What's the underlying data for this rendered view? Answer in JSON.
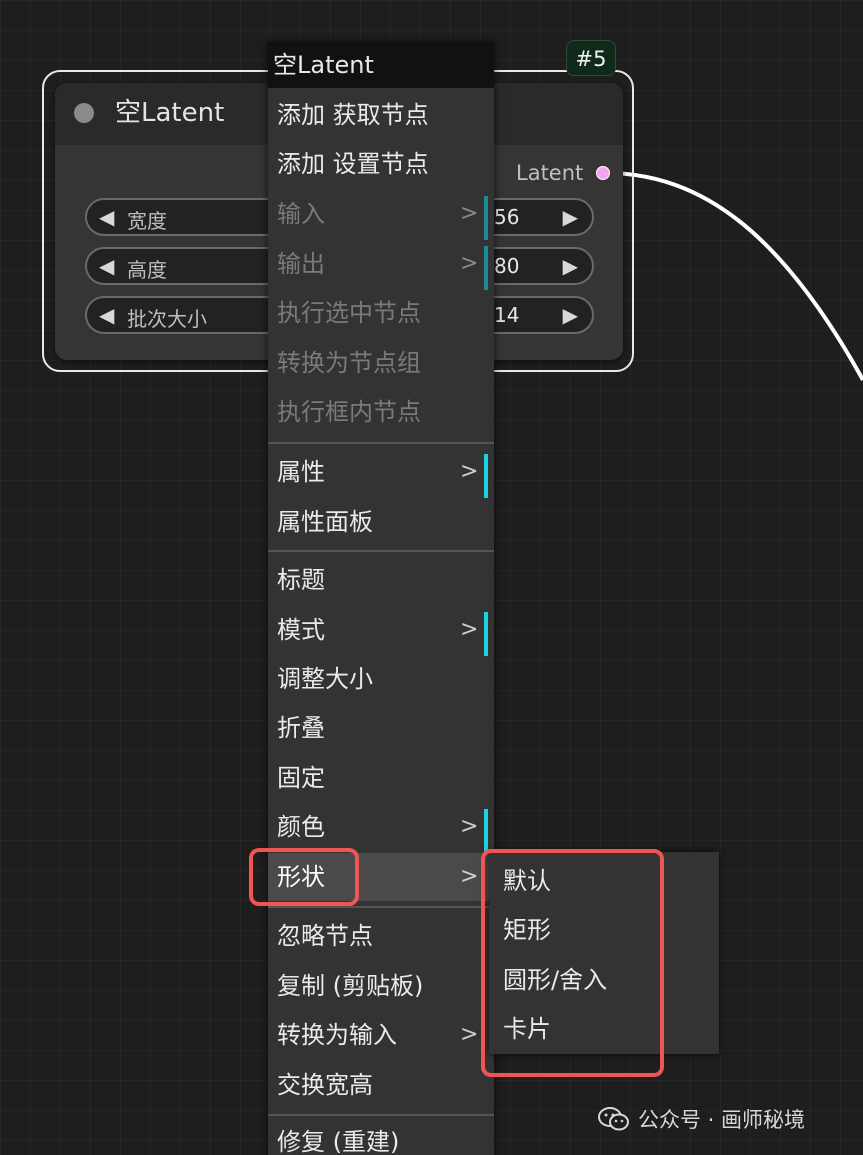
{
  "node": {
    "title": "空Latent",
    "badge": "#5",
    "output_label": "Latent",
    "widgets": [
      {
        "label": "宽度",
        "value": "56"
      },
      {
        "label": "高度",
        "value": "80"
      },
      {
        "label": "批次大小",
        "value": "14"
      }
    ],
    "colors": {
      "output_slot": "#f7a4f2",
      "outline": "#e8e8e8"
    }
  },
  "menu": {
    "title": "空Latent",
    "submenu_arrow": ">",
    "items": [
      {
        "label": "添加 获取节点",
        "disabled": false,
        "has_sub": false
      },
      {
        "label": "添加 设置节点",
        "disabled": false,
        "has_sub": false
      },
      {
        "label": "输入",
        "disabled": true,
        "has_sub": true
      },
      {
        "label": "输出",
        "disabled": true,
        "has_sub": true
      },
      {
        "label": "执行选中节点",
        "disabled": true,
        "has_sub": false
      },
      {
        "label": "转换为节点组",
        "disabled": true,
        "has_sub": false
      },
      {
        "label": "执行框内节点",
        "disabled": true,
        "has_sub": false
      },
      {
        "label": "属性",
        "disabled": false,
        "has_sub": true
      },
      {
        "label": "属性面板",
        "disabled": false,
        "has_sub": false
      },
      {
        "label": "标题",
        "disabled": false,
        "has_sub": false
      },
      {
        "label": "模式",
        "disabled": false,
        "has_sub": true
      },
      {
        "label": "调整大小",
        "disabled": false,
        "has_sub": false
      },
      {
        "label": "折叠",
        "disabled": false,
        "has_sub": false
      },
      {
        "label": "固定",
        "disabled": false,
        "has_sub": false
      },
      {
        "label": "颜色",
        "disabled": false,
        "has_sub": true
      },
      {
        "label": "形状",
        "disabled": false,
        "has_sub": true,
        "highlighted": true
      },
      {
        "label": "忽略节点",
        "disabled": false,
        "has_sub": false
      },
      {
        "label": "复制 (剪贴板)",
        "disabled": false,
        "has_sub": false
      },
      {
        "label": "转换为输入",
        "disabled": false,
        "has_sub": true
      },
      {
        "label": "交换宽高",
        "disabled": false,
        "has_sub": false
      },
      {
        "label": "修复 (重建)",
        "disabled": false,
        "has_sub": false
      }
    ]
  },
  "shape_submenu": {
    "items": [
      "默认",
      "矩形",
      "圆形/舍入",
      "卡片"
    ]
  },
  "annotation_color": "#f05555",
  "watermark": {
    "text": "公众号 · 画师秘境",
    "icon": "wechat-icon"
  }
}
